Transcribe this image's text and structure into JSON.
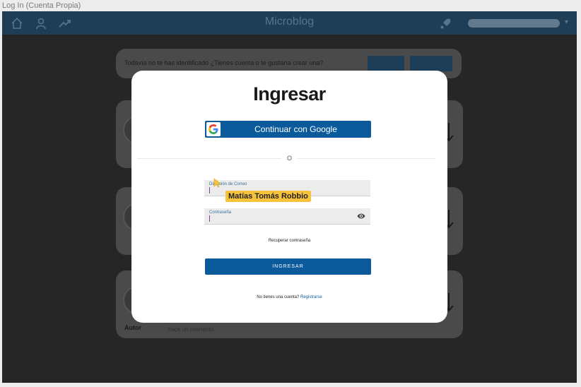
{
  "window": {
    "title": "Log In (Cuenta Propia)"
  },
  "navbar": {
    "title": "Microblog",
    "icons": [
      "home-icon",
      "user-icon",
      "trending-icon",
      "rocket-icon"
    ]
  },
  "background": {
    "banner_text": "Todavía no te has identificado ¿Tienes cuenta o te gustaría crear una?",
    "card_date": "hace un momento",
    "card_name": "Autor"
  },
  "modal": {
    "title": "Ingresar",
    "google_button": "Continuar con Google",
    "divider_text": "O",
    "email_label": "Dirección de Correo",
    "password_label": "Contraseña",
    "recover_link": "Recuperar contraseña",
    "submit_button": "INGRESAR",
    "register_prompt": "No tienes una cuenta?",
    "register_link": "Registrarse"
  },
  "overlay": {
    "cursor_name": "Matías Tomás Robbio"
  },
  "colors": {
    "primary": "#0a5a9c",
    "navbar": "#1e3e57",
    "backdrop": "#262626",
    "name_tag": "#f7c33c"
  }
}
